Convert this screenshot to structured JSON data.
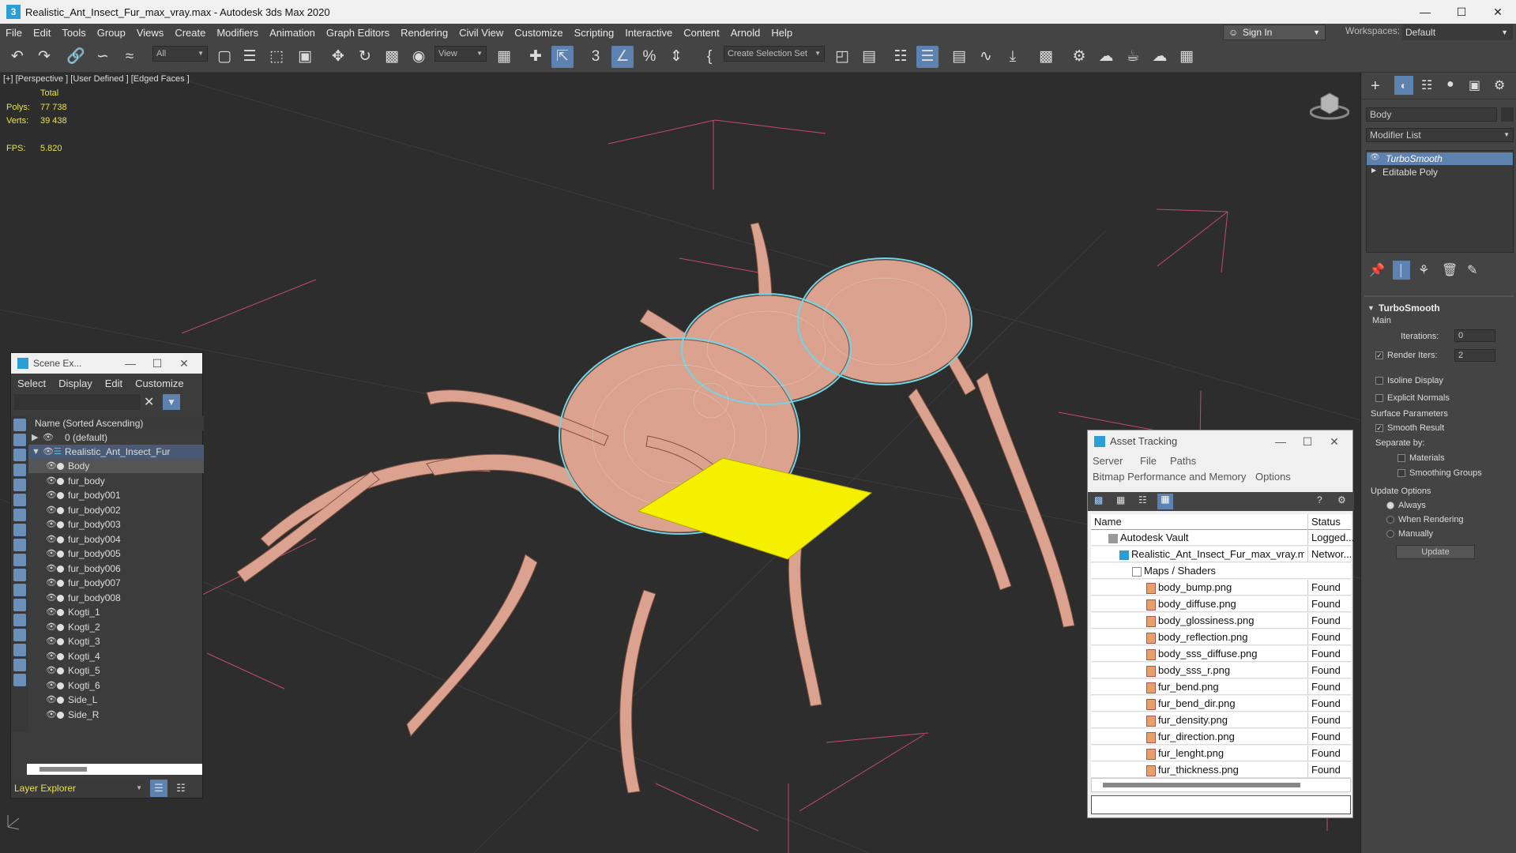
{
  "title_bar": {
    "title": "Realistic_Ant_Insect_Fur_max_vray.max - Autodesk 3ds Max 2020"
  },
  "menu": {
    "items": [
      "File",
      "Edit",
      "Tools",
      "Group",
      "Views",
      "Create",
      "Modifiers",
      "Animation",
      "Graph Editors",
      "Rendering",
      "Civil View",
      "Customize",
      "Scripting",
      "Interactive",
      "Content",
      "Arnold",
      "Help"
    ],
    "sign_in": "Sign In",
    "workspaces_label": "Workspaces:",
    "workspace_value": "Default"
  },
  "toolbar": {
    "filter_value": "All",
    "view_value": "View",
    "selection_set_placeholder": "Create Selection Set"
  },
  "viewport": {
    "label": "[+] [Perspective ] [User Defined ] [Edged Faces ]",
    "stats": {
      "total_label": "Total",
      "polys_label": "Polys:",
      "polys_value": "77 738",
      "verts_label": "Verts:",
      "verts_value": "39 438",
      "fps_label": "FPS:",
      "fps_value": "5.820"
    }
  },
  "scene_explorer": {
    "title": "Scene Ex...",
    "menus": [
      "Select",
      "Display",
      "Edit",
      "Customize"
    ],
    "column_header": "Name (Sorted Ascending)",
    "layer_default": "0 (default)",
    "layer_main": "Realistic_Ant_Insect_Fur",
    "objects": [
      "Body",
      "fur_body",
      "fur_body001",
      "fur_body002",
      "fur_body003",
      "fur_body004",
      "fur_body005",
      "fur_body006",
      "fur_body007",
      "fur_body008",
      "Kogti_1",
      "Kogti_2",
      "Kogti_3",
      "Kogti_4",
      "Kogti_5",
      "Kogti_6",
      "Side_L",
      "Side_R"
    ],
    "footer": "Layer Explorer"
  },
  "asset_tracking": {
    "title": "Asset Tracking",
    "menus": [
      "Server",
      "File",
      "Paths",
      "Bitmap Performance and Memory",
      "Options"
    ],
    "col_name": "Name",
    "col_status": "Status",
    "rows": [
      {
        "name": "Autodesk Vault",
        "status": "Logged..."
      },
      {
        "name": "Realistic_Ant_Insect_Fur_max_vray.max",
        "status": "Networ..."
      },
      {
        "name": "Maps / Shaders",
        "status": ""
      },
      {
        "name": "body_bump.png",
        "status": "Found"
      },
      {
        "name": "body_diffuse.png",
        "status": "Found"
      },
      {
        "name": "body_glossiness.png",
        "status": "Found"
      },
      {
        "name": "body_reflection.png",
        "status": "Found"
      },
      {
        "name": "body_sss_diffuse.png",
        "status": "Found"
      },
      {
        "name": "body_sss_r.png",
        "status": "Found"
      },
      {
        "name": "fur_bend.png",
        "status": "Found"
      },
      {
        "name": "fur_bend_dir.png",
        "status": "Found"
      },
      {
        "name": "fur_density.png",
        "status": "Found"
      },
      {
        "name": "fur_direction.png",
        "status": "Found"
      },
      {
        "name": "fur_lenght.png",
        "status": "Found"
      },
      {
        "name": "fur_thickness.png",
        "status": "Found"
      }
    ]
  },
  "command_panel": {
    "object_name": "Body",
    "modifier_list": "Modifier List",
    "stack": [
      "TurboSmooth",
      "Editable Poly"
    ],
    "rollout_title": "TurboSmooth",
    "main_label": "Main",
    "iterations_label": "Iterations:",
    "iterations_value": "0",
    "render_iters_label": "Render Iters:",
    "render_iters_value": "2",
    "isoline": "Isoline Display",
    "explicit_normals": "Explicit Normals",
    "surface_params": "Surface Parameters",
    "smooth_result": "Smooth Result",
    "separate_by": "Separate by:",
    "materials": "Materials",
    "smoothing_groups": "Smoothing Groups",
    "update_options": "Update Options",
    "always": "Always",
    "when_rendering": "When Rendering",
    "manually": "Manually",
    "update_button": "Update"
  }
}
